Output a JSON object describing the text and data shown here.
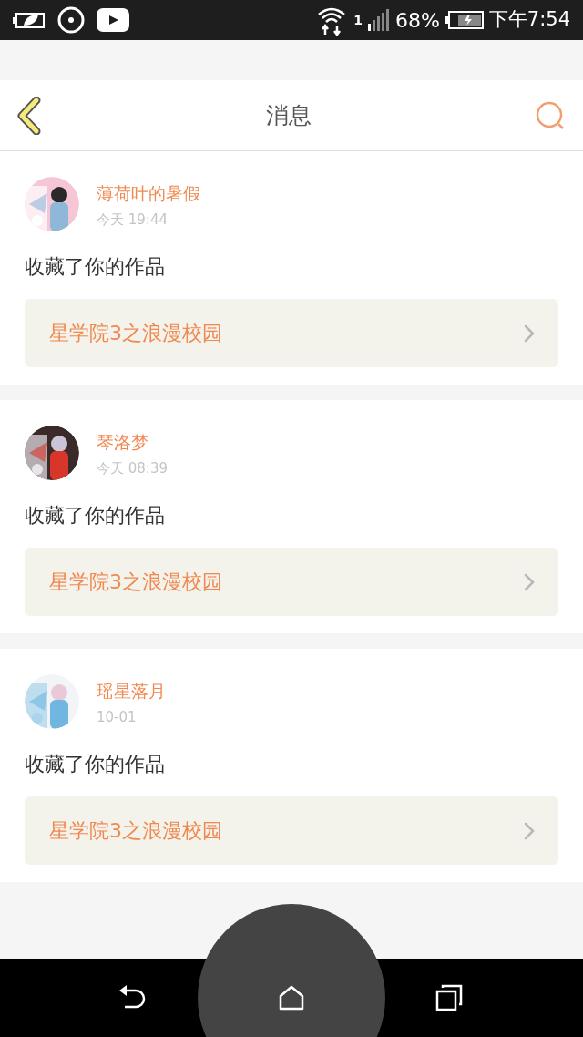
{
  "status_bar": {
    "signal_label": "1",
    "battery": "68%",
    "time": "下午7:54"
  },
  "header": {
    "title": "消息"
  },
  "messages": [
    {
      "user": "薄荷叶的暑假",
      "time": "今天 19:44",
      "action": "收藏了你的作品",
      "work": "星学院3之浪漫校园"
    },
    {
      "user": "琴洛梦",
      "time": "今天 08:39",
      "action": "收藏了你的作品",
      "work": "星学院3之浪漫校园"
    },
    {
      "user": "瑶星落月",
      "time": "10-01",
      "action": "收藏了你的作品",
      "work": "星学院3之浪漫校园"
    }
  ]
}
